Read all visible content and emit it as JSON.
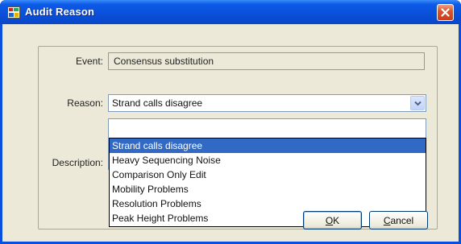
{
  "window": {
    "title": "Audit Reason",
    "close_icon": "close-icon",
    "title_icon": "app-icon"
  },
  "form": {
    "event_label": "Event:",
    "event_value": "Consensus substitution",
    "reason_label": "Reason:",
    "reason_value": "Strand calls disagree",
    "description_label": "Description:"
  },
  "dropdown": {
    "options": [
      "Strand calls disagree",
      "Heavy Sequencing Noise",
      "Comparison Only Edit",
      "Mobility Problems",
      "Resolution Problems",
      "Peak Height Problems"
    ],
    "selected_index": 0
  },
  "buttons": {
    "ok_mnemonic": "O",
    "ok_rest": "K",
    "cancel_mnemonic": "C",
    "cancel_rest": "ancel"
  },
  "colors": {
    "titlebar": "#0a4fd9",
    "selection": "#316ac5",
    "client_bg": "#ece9d8"
  }
}
